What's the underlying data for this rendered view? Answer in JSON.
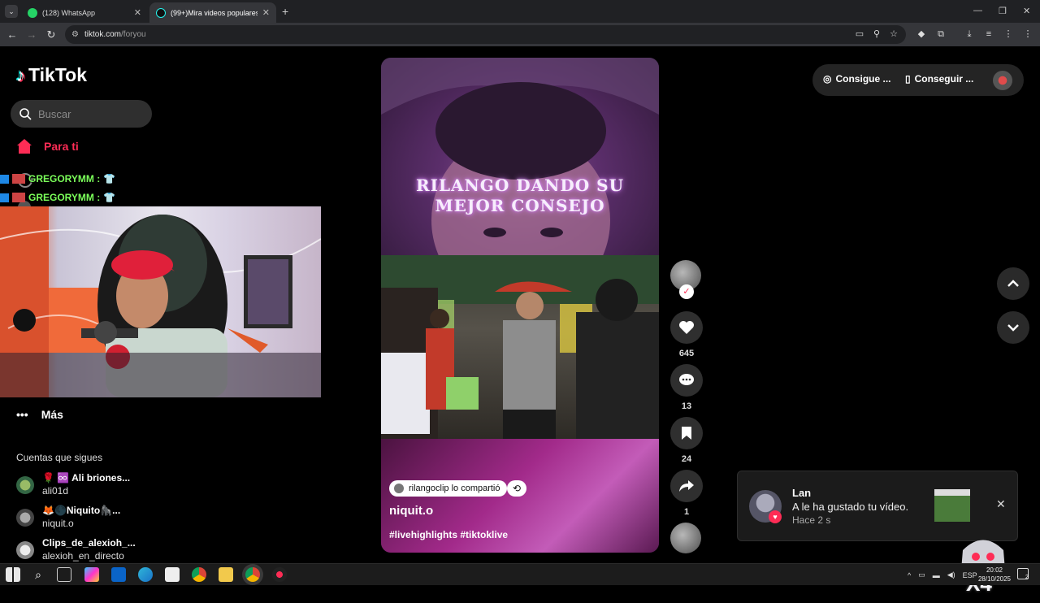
{
  "browser": {
    "tabs": [
      {
        "title": "(128) WhatsApp",
        "active": false
      },
      {
        "title": "(99+)Mira videos populares sel",
        "active": true
      }
    ],
    "address": {
      "host": "tiktok.com",
      "path": "/foryou"
    }
  },
  "sidebar": {
    "brand": "TikTok",
    "search_placeholder": "Buscar",
    "nav_foryou": "Para ti",
    "nav_more": "Más",
    "following_title": "Cuentas que sigues",
    "following": [
      {
        "name": "🌹 ♾️ Ali briones...",
        "handle": "ali01d"
      },
      {
        "name": "🦊🌑Niquito🦍...",
        "handle": "niquit.o"
      },
      {
        "name": "Clips_de_alexioh_...",
        "handle": "alexioh_en_directo"
      }
    ]
  },
  "chat_overlay": [
    {
      "user": "GREGORYMM :"
    },
    {
      "user": "GREGORYMM :"
    }
  ],
  "video": {
    "caption": "RILANGO DANDO SU MEJOR CONSEJO",
    "shared_label": "rilangoclip lo compartió",
    "author": "niquit.o",
    "hashtags": "#livehighlights #tiktoklive"
  },
  "actions": {
    "likes": "645",
    "comments": "13",
    "saves": "24",
    "shares": "1"
  },
  "top_right": {
    "coins_label": "Consigue ...",
    "app_label": "Conseguir ..."
  },
  "notification": {
    "user": "Lan",
    "message": "A le ha gustado tu vídeo.",
    "time": "Hace 2 s"
  },
  "overlay_badge": "X4",
  "taskbar": {
    "language": "ESP",
    "time": "20:02",
    "date": "28/10/2025",
    "notifications": "2"
  },
  "colors": {
    "accent": "#fe2c55",
    "background": "#000000"
  }
}
